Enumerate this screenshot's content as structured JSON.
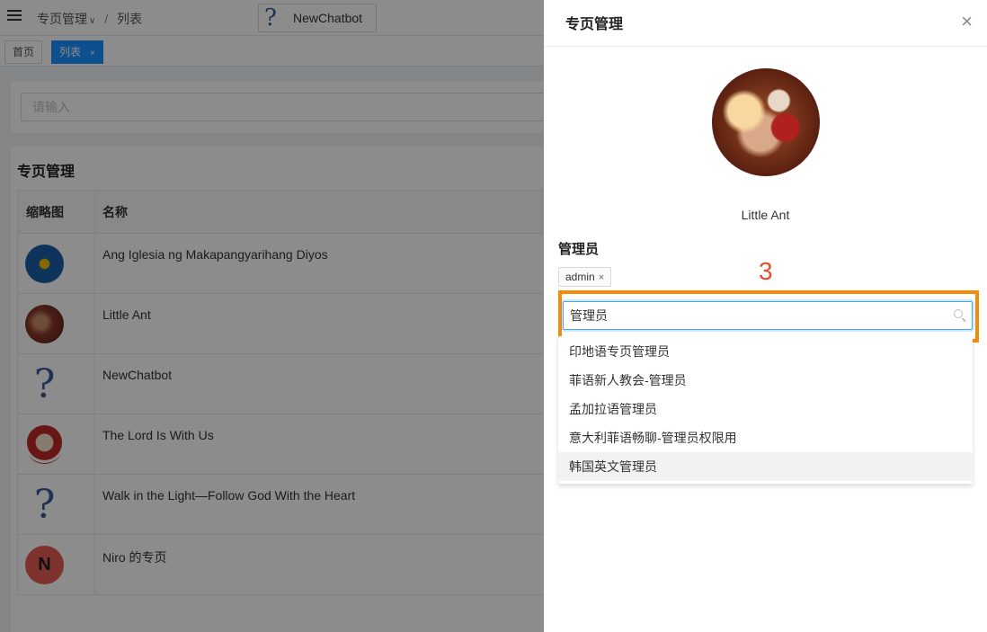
{
  "topbar": {
    "breadcrumb_parent": "专页管理",
    "breadcrumb_sep": "/",
    "breadcrumb_current": "列表",
    "page_switch_label": "NewChatbot"
  },
  "tabs": [
    {
      "label": "首页"
    },
    {
      "label": "列表",
      "close": "×"
    }
  ],
  "search": {
    "placeholder": "请输入"
  },
  "list": {
    "title": "专页管理",
    "columns": [
      "缩略图",
      "名称"
    ],
    "rows": [
      {
        "name": "Ang Iglesia ng Makapangyarihang Diyos",
        "thumb": "logo"
      },
      {
        "name": "Little Ant",
        "thumb": "photo"
      },
      {
        "name": "NewChatbot",
        "thumb": "question"
      },
      {
        "name": "The Lord Is With Us",
        "thumb": "badge"
      },
      {
        "name": "Walk in the Light—Follow God With the Heart",
        "thumb": "question"
      },
      {
        "name": "Niro 的专页",
        "thumb": "N"
      }
    ]
  },
  "drawer": {
    "title": "专页管理",
    "close": "×",
    "page_name": "Little Ant",
    "admins_label": "管理员",
    "tags": [
      {
        "label": "admin",
        "close": "×"
      }
    ],
    "step_marker": "3",
    "select_value": "管理员",
    "options": [
      "印地语专页管理员",
      "菲语新人教会-管理员",
      "孟加拉语管理员",
      "意大利菲语畅聊-管理员权限用",
      "韩国英文管理员"
    ]
  },
  "colors": {
    "primary": "#1890ff",
    "highlight": "#f88a0a",
    "step": "#e84a2a"
  }
}
